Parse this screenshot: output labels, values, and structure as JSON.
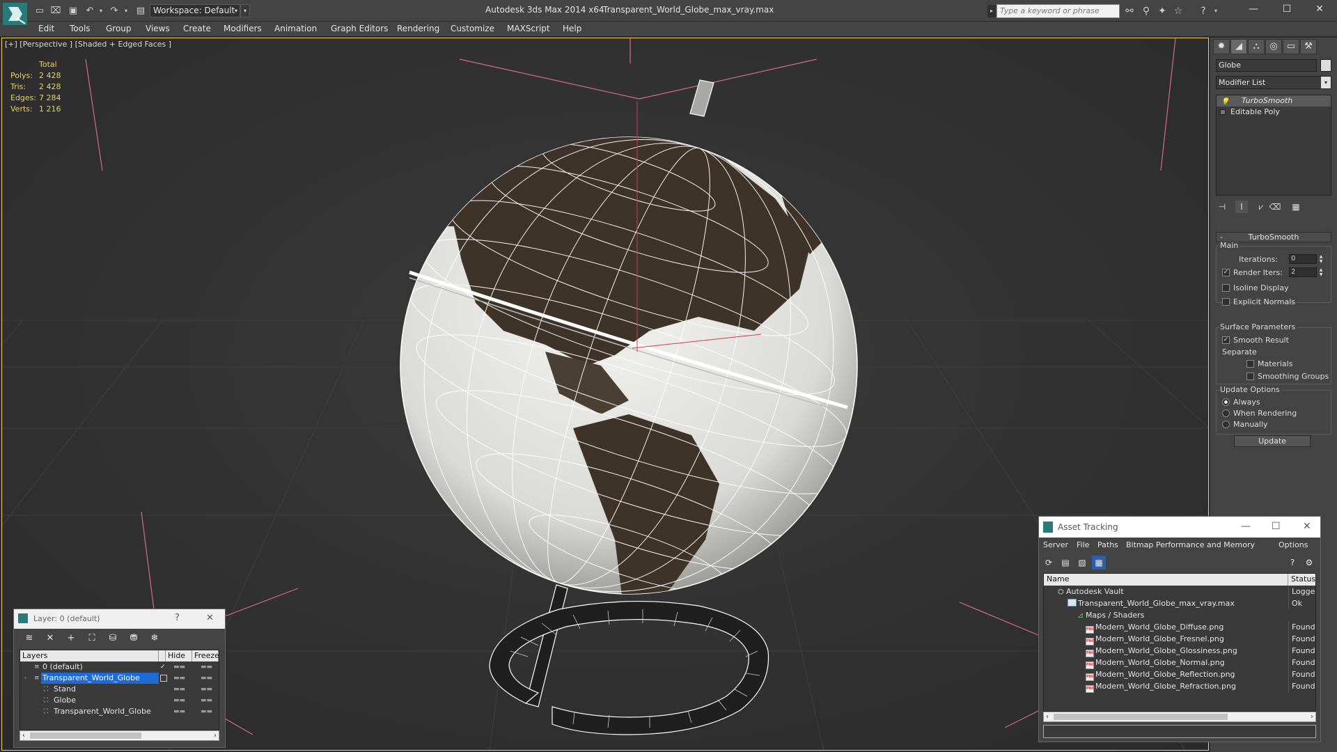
{
  "titlebar": {
    "workspace": "Workspace: Default",
    "app_title": "Autodesk 3ds Max  2014 x64",
    "file_title": "Transparent_World_Globe_max_vray.max",
    "search_placeholder": "Type a keyword or phrase",
    "icons": [
      "new-icon",
      "open-icon",
      "save-icon",
      "undo-icon",
      "redo-icon",
      "project-icon"
    ]
  },
  "menu": {
    "items": [
      "Edit",
      "Tools",
      "Group",
      "Views",
      "Create",
      "Modifiers",
      "Animation",
      "Graph Editors",
      "Rendering",
      "Customize",
      "MAXScript",
      "Help"
    ]
  },
  "viewport": {
    "label": "[+] [Perspective ] [Shaded + Edged Faces ]",
    "stats": {
      "header": "Total",
      "rows": [
        {
          "label": "Polys:",
          "value": "2 428"
        },
        {
          "label": "Tris:",
          "value": "2 428"
        },
        {
          "label": "Edges:",
          "value": "7 284"
        },
        {
          "label": "Verts:",
          "value": "1 216"
        }
      ]
    }
  },
  "command_panel": {
    "object_name": "Globe",
    "modifier_list": "Modifier List",
    "stack": [
      "TurboSmooth",
      "Editable Poly"
    ],
    "rollout_title": "TurboSmooth",
    "main_group": "Main",
    "iterations_label": "Iterations:",
    "iterations_value": "0",
    "render_iters_label": "Render Iters:",
    "render_iters_value": "2",
    "isoline_label": "Isoline Display",
    "explicit_normals_label": "Explicit Normals",
    "surface_group": "Surface Parameters",
    "smooth_result_label": "Smooth Result",
    "separate_label": "Separate",
    "materials_label": "Materials",
    "smoothing_groups_label": "Smoothing Groups",
    "update_group": "Update Options",
    "always_label": "Always",
    "when_rendering_label": "When Rendering",
    "manually_label": "Manually",
    "update_button": "Update",
    "checks": {
      "render_iters": true,
      "isoline": false,
      "explicit_normals": false,
      "smooth_result": true,
      "materials": false,
      "smoothing_groups": false
    },
    "update_option_selected": "Always"
  },
  "layer_dialog": {
    "title": "Layer: 0 (default)",
    "help": "?",
    "columns": [
      "Layers",
      "Hide",
      "Freeze"
    ],
    "rows": [
      {
        "name": "0 (default)",
        "level": 1
      },
      {
        "name": "Transparent_World_Globe",
        "level": 1
      },
      {
        "name": "Stand",
        "level": 2
      },
      {
        "name": "Globe",
        "level": 2
      },
      {
        "name": "Transparent_World_Globe",
        "level": 2
      }
    ]
  },
  "asset_tracking": {
    "title": "Asset Tracking",
    "menu": [
      "Server",
      "File",
      "Paths",
      "Bitmap Performance and Memory",
      "Options"
    ],
    "columns": [
      "Name",
      "Status"
    ],
    "rows": [
      {
        "name": "Autodesk Vault",
        "status": "Logged O",
        "level": 0,
        "icon": "vault-icon"
      },
      {
        "name": "Transparent_World_Globe_max_vray.max",
        "status": "Ok",
        "level": 1,
        "icon": "max-file-icon"
      },
      {
        "name": "Maps / Shaders",
        "status": "",
        "level": 2,
        "icon": "maps-folder-icon"
      },
      {
        "name": "Modern_World_Globe_Diffuse.png",
        "status": "Found",
        "level": 3,
        "icon": "png-icon"
      },
      {
        "name": "Modern_World_Globe_Fresnel.png",
        "status": "Found",
        "level": 3,
        "icon": "png-icon"
      },
      {
        "name": "Modern_World_Globe_Glossiness.png",
        "status": "Found",
        "level": 3,
        "icon": "png-icon"
      },
      {
        "name": "Modern_World_Globe_Normal.png",
        "status": "Found",
        "level": 3,
        "icon": "png-icon"
      },
      {
        "name": "Modern_World_Globe_Reflection.png",
        "status": "Found",
        "level": 3,
        "icon": "png-icon"
      },
      {
        "name": "Modern_World_Globe_Refraction.png",
        "status": "Found",
        "level": 3,
        "icon": "png-icon"
      }
    ]
  },
  "colors": {
    "accent_teal": "#2b7a7a",
    "viewport_border": "#f2d06b",
    "stats_text": "#e8d36a",
    "selection": "#1f6bd6"
  }
}
